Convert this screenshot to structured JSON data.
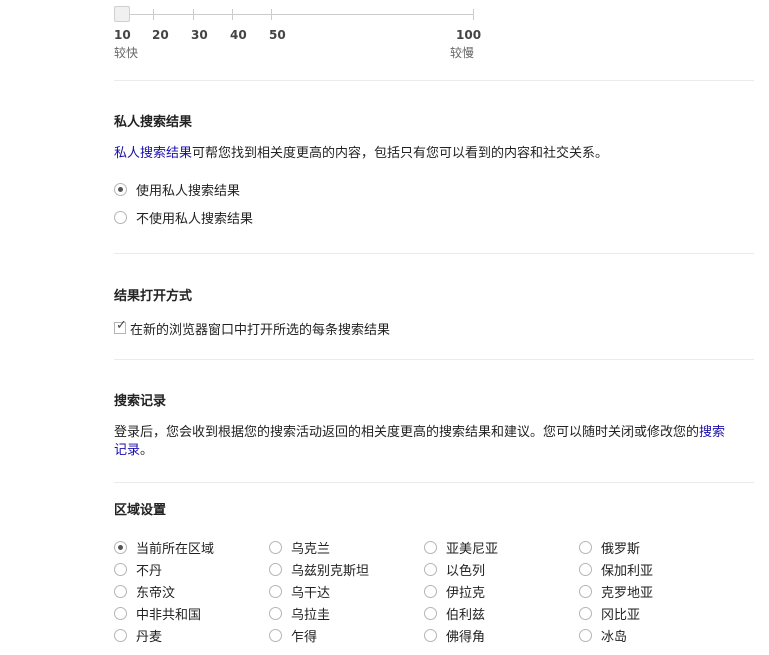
{
  "speed_slider": {
    "ticks": [
      "10",
      "20",
      "30",
      "40",
      "50",
      "100"
    ],
    "left_caption": "较快",
    "right_caption": "较慢",
    "current_value": 10
  },
  "private_results": {
    "title": "私人搜索结果",
    "description_link": "私人搜索结果",
    "description_rest": "可帮您找到相关度更高的内容，包括只有您可以看到的内容和社交关系。",
    "options": [
      {
        "label": "使用私人搜索结果",
        "checked": true
      },
      {
        "label": "不使用私人搜索结果",
        "checked": false
      }
    ]
  },
  "open_results": {
    "title": "结果打开方式",
    "checkbox_label": "在新的浏览器窗口中打开所选的每条搜索结果",
    "checked": true
  },
  "search_history": {
    "title": "搜索记录",
    "text_before": "登录后，您会收到根据您的搜索活动返回的相关度更高的搜索结果和建议。您可以随时关闭或修改您的",
    "link_part1": "搜索",
    "link_part2": "记录",
    "text_after": "。"
  },
  "region": {
    "title": "区域设置",
    "columns": [
      [
        "当前所在区域",
        "不丹",
        "东帝汶",
        "中非共和国",
        "丹麦"
      ],
      [
        "乌克兰",
        "乌兹别克斯坦",
        "乌干达",
        "乌拉圭",
        "乍得"
      ],
      [
        "亚美尼亚",
        "以色列",
        "伊拉克",
        "伯利兹",
        "佛得角"
      ],
      [
        "俄罗斯",
        "保加利亚",
        "克罗地亚",
        "冈比亚",
        "冰岛"
      ]
    ],
    "selected": "当前所在区域"
  }
}
